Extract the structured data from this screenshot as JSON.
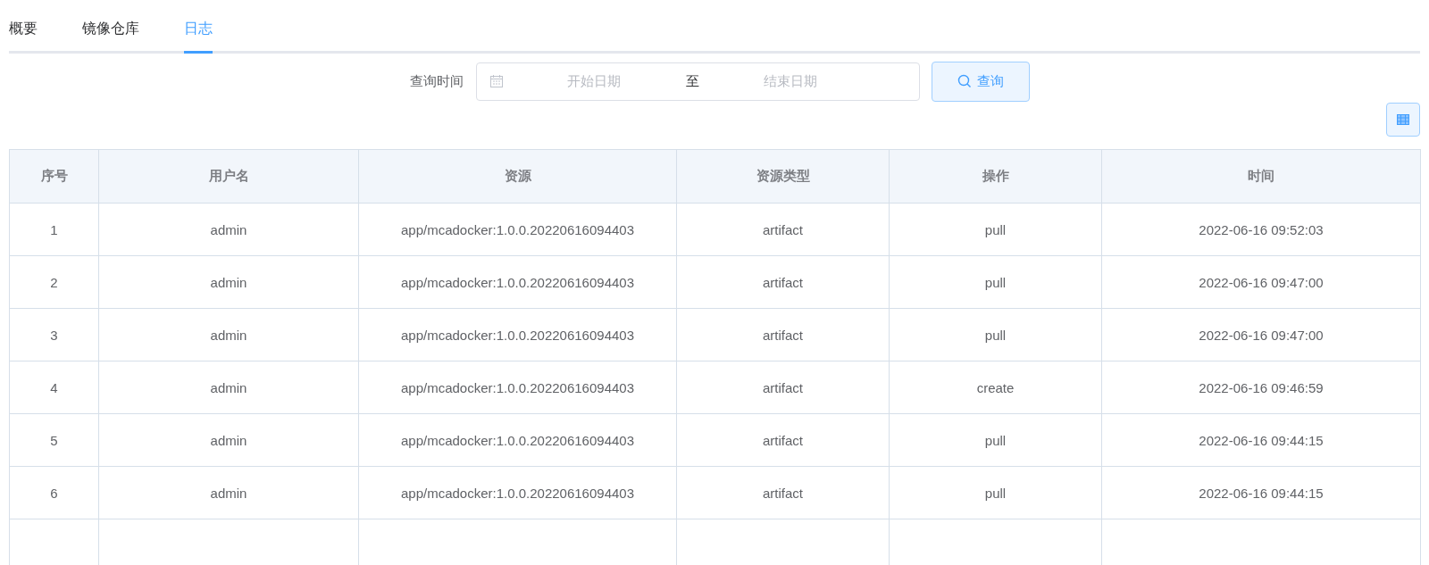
{
  "tabs": [
    {
      "label": "概要",
      "selected": false
    },
    {
      "label": "镜像仓库",
      "selected": false
    },
    {
      "label": "日志",
      "selected": true
    }
  ],
  "filter": {
    "label": "查询时间",
    "start_placeholder": "开始日期",
    "separator": "至",
    "end_placeholder": "结束日期",
    "button": "查询"
  },
  "table": {
    "columns": [
      "序号",
      "用户名",
      "资源",
      "资源类型",
      "操作",
      "时间"
    ],
    "rows": [
      [
        "1",
        "admin",
        "app/mcadocker:1.0.0.20220616094403",
        "artifact",
        "pull",
        "2022-06-16 09:52:03"
      ],
      [
        "2",
        "admin",
        "app/mcadocker:1.0.0.20220616094403",
        "artifact",
        "pull",
        "2022-06-16 09:47:00"
      ],
      [
        "3",
        "admin",
        "app/mcadocker:1.0.0.20220616094403",
        "artifact",
        "pull",
        "2022-06-16 09:47:00"
      ],
      [
        "4",
        "admin",
        "app/mcadocker:1.0.0.20220616094403",
        "artifact",
        "create",
        "2022-06-16 09:46:59"
      ],
      [
        "5",
        "admin",
        "app/mcadocker:1.0.0.20220616094403",
        "artifact",
        "pull",
        "2022-06-16 09:44:15"
      ],
      [
        "6",
        "admin",
        "app/mcadocker:1.0.0.20220616094403",
        "artifact",
        "pull",
        "2022-06-16 09:44:15"
      ]
    ]
  }
}
